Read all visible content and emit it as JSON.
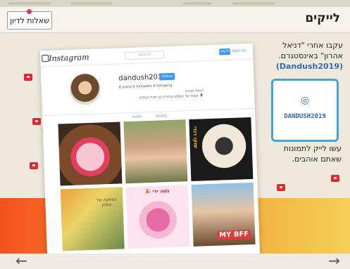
{
  "header": {
    "title": "לייקים",
    "questions_button": "שאלות לדיון"
  },
  "instagram": {
    "logo": "Instagram",
    "search_placeholder": "Search",
    "login": "Log In",
    "signup": "Sign Up",
    "username": "dandush2019",
    "follow": "Follow",
    "stats": "8 posts   0 followers   8 following",
    "bio_name": "דניאל אהרון",
    "bio_text": "🌻 שבתי על העולם ובחרתי בך מכל העולם",
    "tab_posts": "POSTS",
    "tab_tagged": "TAGGED",
    "grid_labels": [
      "",
      "",
      "שוקו רנדי",
      "",
      "נשה ידי 🎉",
      "MY BFF"
    ],
    "grid_overlay_texts": [
      "",
      "",
      "",
      "הפתעה של עמוק",
      "",
      ""
    ]
  },
  "panel": {
    "line1": "עקבו אחרי \"דניאל",
    "line2": "אהרון\" באינסטגרם.",
    "handle": "(Dandush2019)",
    "nametag": "DANDUSH2019",
    "likes_line1": "עשו לייק לתמונות",
    "likes_line2": "שאתם אוהבים."
  },
  "nav": {
    "prev": "←",
    "next": "→"
  },
  "colors": {
    "heart": "#e2292e",
    "nametag_border": "#3ea6d9",
    "handle": "#2e6ab3"
  }
}
